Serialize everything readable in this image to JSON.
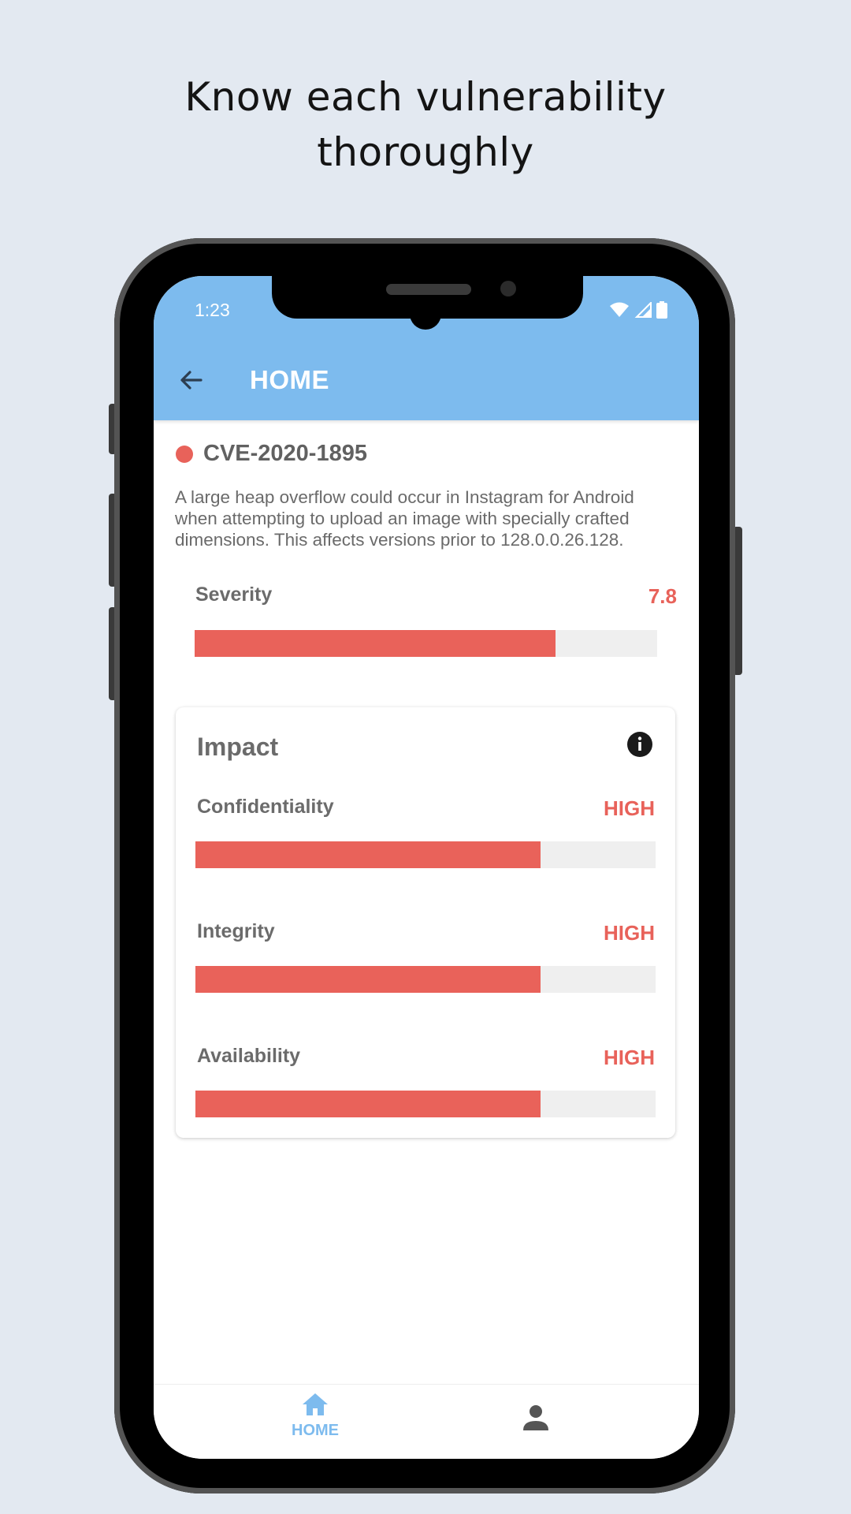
{
  "headline": {
    "line1": "Know each vulnerability",
    "line2": "thoroughly"
  },
  "status_bar": {
    "time": "1:23",
    "icons": [
      "wifi-icon",
      "signal-icon",
      "battery-icon"
    ]
  },
  "app_bar": {
    "title": "HOME",
    "back_icon": "arrow-left-icon"
  },
  "vulnerability": {
    "id": "CVE-2020-1895",
    "status_color": "#e8625a",
    "description": "A large heap overflow could occur in Instagram for Android when attempting to upload an image with specially crafted dimensions. This affects versions prior to 128.0.0.26.128.",
    "severity": {
      "label": "Severity",
      "value": "7.8",
      "fill_fraction": 0.78
    }
  },
  "impact": {
    "title": "Impact",
    "info_icon": "info-icon",
    "metrics": [
      {
        "label": "Confidentiality",
        "value": "HIGH",
        "fill_fraction": 0.75
      },
      {
        "label": "Integrity",
        "value": "HIGH",
        "fill_fraction": 0.75
      },
      {
        "label": "Availability",
        "value": "HIGH",
        "fill_fraction": 0.75
      }
    ]
  },
  "bottom_nav": {
    "home_label": "HOME",
    "home_icon": "home-icon",
    "profile_icon": "person-icon"
  },
  "colors": {
    "accent": "#7dbbee",
    "danger": "#e8625a",
    "background": "#e3e9f1"
  }
}
